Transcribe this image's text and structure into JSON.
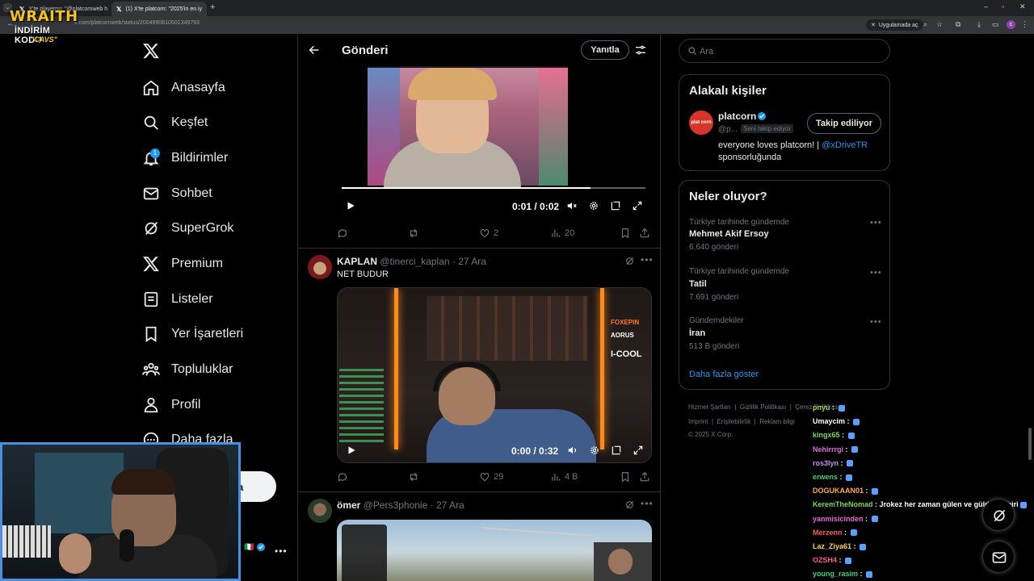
{
  "browser": {
    "tabs": [
      {
        "label": "X'te playernn: \"@platcornweb h"
      },
      {
        "label": "(1) X'te platcorn: \"2025'in en iy"
      }
    ],
    "url_prefix": "x.com/",
    "url": "platcornweb/status/2004990810501349793",
    "open_app_label": "Uygulamada aç"
  },
  "overlay": {
    "brand": "WRAITH",
    "discount": "İNDİRİM KODU",
    "code": "\"CAVS\""
  },
  "nav": {
    "items": [
      {
        "label": "Anasayfa"
      },
      {
        "label": "Keşfet"
      },
      {
        "label": "Bildirimler",
        "badge": "1"
      },
      {
        "label": "Sohbet"
      },
      {
        "label": "SuperGrok"
      },
      {
        "label": "Premium"
      },
      {
        "label": "Listeler"
      },
      {
        "label": "Yer İşaretleri"
      },
      {
        "label": "Topluluklar"
      },
      {
        "label": "Profil"
      },
      {
        "label": "Daha fazla"
      }
    ],
    "post_label": "a"
  },
  "header": {
    "title": "Gönderi",
    "reply_label": "Yanıtla"
  },
  "video1": {
    "time": "0:01 / 0:02",
    "progress": 0.82
  },
  "post1_actions": {
    "likes": "2",
    "views": "20"
  },
  "tweet2": {
    "name": "KAPLAN",
    "handle": "@tinerci_kaplan",
    "date": "· 27 Ara",
    "text": "NET BUDUR",
    "video_time": "0:00 / 0:32",
    "brands": [
      "FOXEPIN",
      "AORUS",
      "I-COOL"
    ],
    "likes": "29",
    "views": "4 B"
  },
  "tweet3": {
    "name": "ömer",
    "handle": "@Pers3phonie",
    "date": "· 27 Ara"
  },
  "search": {
    "placeholder": "Ara"
  },
  "related": {
    "title": "Alakalı kişiler",
    "name": "platcorn",
    "handle": "@p...",
    "follows_you": "Seni takip ediyor",
    "follow_label": "Takip ediliyor",
    "bio": "everyone loves platcorn! |",
    "bio_link": "@xDriveTR",
    "bio_tail": "sponsorluğunda",
    "avatar_text": "plat corn"
  },
  "trends": {
    "title": "Neler oluyor?",
    "items": [
      {
        "context": "Türkiye tarihinde gündemde",
        "name": "Mehmet Akif Ersoy",
        "count": "6.640 gönderi"
      },
      {
        "context": "Türkiye tarihinde gündemde",
        "name": "Tatil",
        "count": "7.691 gönderi"
      },
      {
        "context": "Gündemdekiler",
        "name": "İran",
        "count": "513 B gönderi"
      }
    ],
    "show_more": "Daha fazla göster"
  },
  "footer": {
    "line1": [
      "Hizmet Şartları",
      "|",
      "Gizlilik Politikası",
      "|",
      "Çerez Politikası",
      "|"
    ],
    "line2": [
      "Imprint",
      "|",
      "Erişilebilirlik",
      "|",
      "Reklam bilgi"
    ],
    "copyright": "© 2025 X Corp."
  },
  "chat": [
    {
      "user": "pnyu",
      "msg": "",
      "color": "#9ad45a"
    },
    {
      "user": "Umaycim",
      "msg": "",
      "color": "#ffffff"
    },
    {
      "user": "kingx65",
      "msg": "",
      "color": "#7ed957"
    },
    {
      "user": "Nehirrrgi",
      "msg": "",
      "color": "#e26bd8"
    },
    {
      "user": "ros3lyn",
      "msg": "",
      "color": "#c78bff"
    },
    {
      "user": "erwens",
      "msg": "",
      "color": "#3ad07a"
    },
    {
      "user": "DOGUKAAN01",
      "msg": "",
      "color": "#ffae42"
    },
    {
      "user": "KeremTheNomad",
      "msg": "Jrokez her zaman gülen ve güldüren biri",
      "color": "#7ed957"
    },
    {
      "user": "yanmisicinden",
      "msg": "",
      "color": "#e26bd8"
    },
    {
      "user": "Merzenn",
      "msg": "",
      "color": "#ff5a5a"
    },
    {
      "user": "Laz_Ziya61",
      "msg": "",
      "color": "#ffd24a"
    },
    {
      "user": "OZSH4",
      "msg": "",
      "color": "#ff5a8a"
    },
    {
      "user": "young_rasim",
      "msg": "",
      "color": "#3ad07a"
    }
  ]
}
